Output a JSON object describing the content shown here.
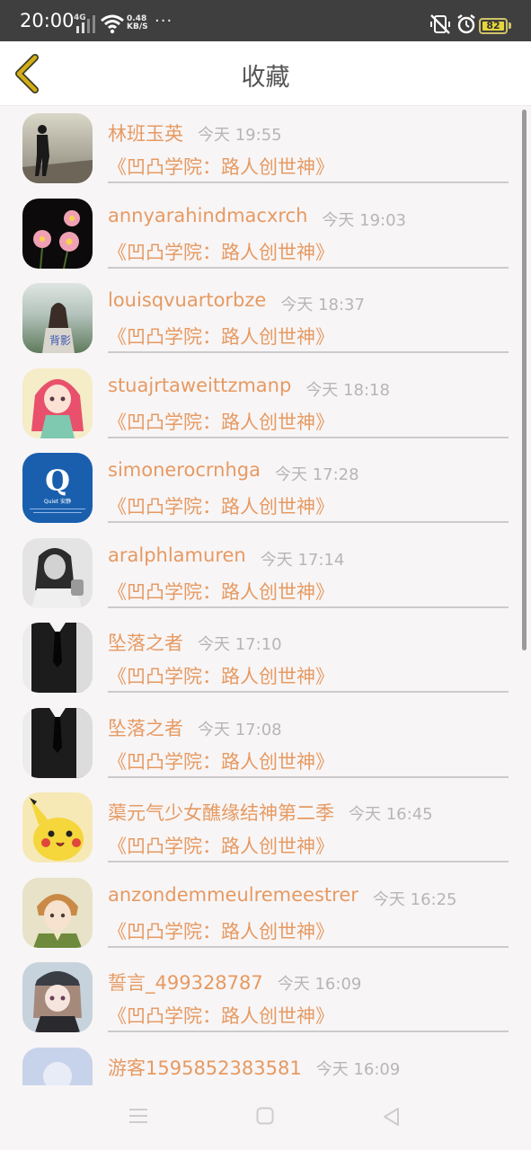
{
  "status_bar": {
    "time": "20:00",
    "network_label": "4G",
    "speed_value": "0.48",
    "speed_unit": "KB/S",
    "more": "···",
    "battery": "82",
    "icons": [
      "signal-icon",
      "wifi-icon",
      "mute-vibrate-icon",
      "alarm-icon",
      "battery-icon"
    ]
  },
  "header": {
    "title": "收藏",
    "back_icon": "chevron-left-icon"
  },
  "colors": {
    "accent": "#e69a62",
    "time_gray": "#b6b6b6",
    "back_chevron": "#c9a514"
  },
  "favorites": [
    {
      "name": "林班玉英",
      "time": "今天 19:55",
      "book": "《凹凸学院：路人创世神》",
      "avatar": "avatar-walking-man"
    },
    {
      "name": "annyarahindmacxrch",
      "time": "今天 19:03",
      "book": "《凹凸学院：路人创世神》",
      "avatar": "avatar-pink-flowers"
    },
    {
      "name": "louisqvuartorbze",
      "time": "今天 18:37",
      "book": "《凹凸学院：路人创世神》",
      "avatar": "avatar-girl-back",
      "avatar_text": "背影"
    },
    {
      "name": "stuajrtaweittzmanp",
      "time": "今天 18:18",
      "book": "《凹凸学院：路人创世神》",
      "avatar": "avatar-pink-anime-girl"
    },
    {
      "name": "simonerocrnhga",
      "time": "今天 17:28",
      "book": "《凹凸学院：路人创世神》",
      "avatar": "avatar-quiet-logo",
      "avatar_text": "Quiet 安静"
    },
    {
      "name": "aralphlamuren",
      "time": "今天 17:14",
      "book": "《凹凸学院：路人创世神》",
      "avatar": "avatar-bw-girl"
    },
    {
      "name": "坠落之者",
      "time": "今天 17:10",
      "book": "《凹凸学院：路人创世神》",
      "avatar": "avatar-suit-tie"
    },
    {
      "name": "坠落之者",
      "time": "今天 17:08",
      "book": "《凹凸学院：路人创世神》",
      "avatar": "avatar-suit-tie"
    },
    {
      "name": "蕖元气少女醮缘结神第二季",
      "time": "今天 16:45",
      "book": "《凹凸学院：路人创世神》",
      "avatar": "avatar-pikachu"
    },
    {
      "name": "anzondemmeulremeestrer",
      "time": "今天 16:25",
      "book": "《凹凸学院：路人创世神》",
      "avatar": "avatar-anime-boy"
    },
    {
      "name": "誓言_499328787",
      "time": "今天 16:09",
      "book": "《凹凸学院：路人创世神》",
      "avatar": "avatar-anime-girl-hat"
    },
    {
      "name": "游客1595852383581",
      "time": "今天 16:09",
      "book": "",
      "avatar": "avatar-default-guest"
    }
  ],
  "nav_bar": {
    "items": [
      "menu-icon",
      "home-square-icon",
      "back-triangle-icon"
    ]
  }
}
